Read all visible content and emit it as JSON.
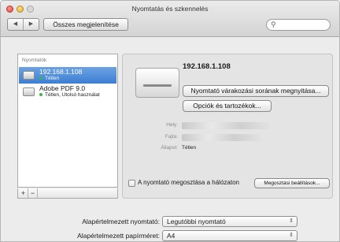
{
  "window": {
    "title": "Nyomtatás és szkennelés",
    "show_all_label": "Összes megjelenítése",
    "nav_back": "◀",
    "nav_forward": "▶",
    "search_placeholder": ""
  },
  "printers": {
    "header": "Nyomtatók",
    "items": [
      {
        "name": "192.168.1.108",
        "status": "Tétlen",
        "selected": true
      },
      {
        "name": "Adobe PDF 9.0",
        "status": "Tétlen, Utolsó használat",
        "selected": false
      }
    ],
    "add_label": "+",
    "remove_label": "−"
  },
  "detail": {
    "printer_title": "192.168.1.108",
    "open_queue_label": "Nyomtató várakozási sorának megnyitása...",
    "options_label": "Opciók és tartozékok...",
    "location_label": "Hely:",
    "kind_label": "Fajta:",
    "status_label": "Állapot:",
    "status_value": "Tétlen",
    "share_label": "A nyomtató megosztása a hálózaton",
    "sharing_prefs_label": "Megosztási beállítások..."
  },
  "defaults": {
    "default_printer_label": "Alapértelmezett nyomtató:",
    "default_printer_value": "Legutóbbi nyomtató",
    "default_paper_label": "Alapértelmezett papírméret:",
    "default_paper_value": "A4"
  },
  "colors": {
    "selection": "#3d7ed3",
    "status_dot": "#3fb34f"
  }
}
